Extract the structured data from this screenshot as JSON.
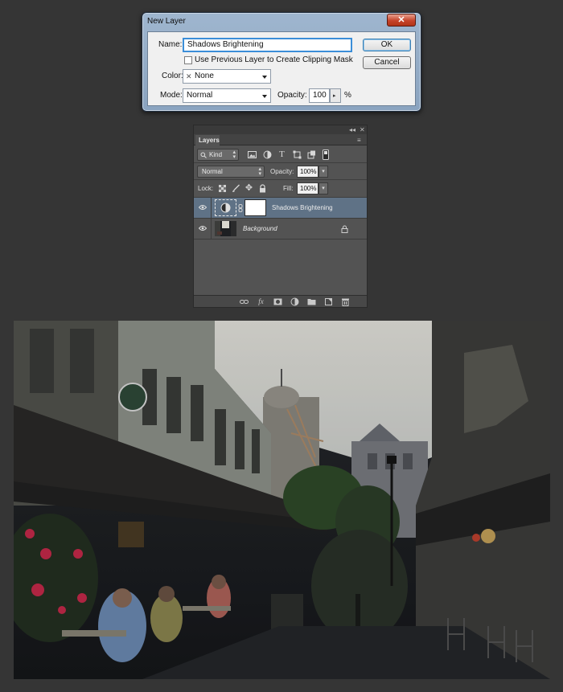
{
  "dialog": {
    "title": "New Layer",
    "close_glyph": "✕",
    "name_label": "Name:",
    "name_value": "Shadows Brightening",
    "clip_checkbox_label": "Use Previous Layer to Create Clipping Mask",
    "clip_checked": false,
    "color_label": "Color:",
    "color_value": "None",
    "color_icon": "x-swatch-icon",
    "mode_label": "Mode:",
    "mode_value": "Normal",
    "opacity_label": "Opacity:",
    "opacity_value": "100",
    "opacity_unit": "%",
    "ok_label": "OK",
    "cancel_label": "Cancel"
  },
  "layers_panel": {
    "tab_label": "Layers",
    "collapse_glyph": "◂◂",
    "close_glyph": "✕",
    "menu_glyph": "≡",
    "filter_value": "Kind",
    "filter_icons": [
      "image-filter-icon",
      "adjustment-filter-icon",
      "type-filter-icon",
      "shape-filter-icon",
      "smart-object-filter-icon",
      "filter-toggle-icon"
    ],
    "blend_mode": "Normal",
    "opacity_label": "Opacity:",
    "opacity_value": "100%",
    "lock_label": "Lock:",
    "lock_icons": [
      "lock-transparent-icon",
      "lock-image-icon",
      "lock-position-icon",
      "lock-all-icon"
    ],
    "fill_label": "Fill:",
    "fill_value": "100%",
    "layers": [
      {
        "name": "Shadows Brightening",
        "selected": true,
        "type": "adjustment",
        "visible": true
      },
      {
        "name": "Background",
        "selected": false,
        "type": "image",
        "visible": true,
        "locked": true
      }
    ],
    "bottom_icons": [
      "link-layers-icon",
      "fx-icon",
      "add-mask-icon",
      "new-adjustment-icon",
      "new-group-icon",
      "new-layer-icon",
      "delete-layer-icon"
    ],
    "fx_glyph": "fx"
  },
  "photo": {
    "description_icon": "street-photo",
    "sky_color": "#e3e2da",
    "shade_color": "#1f2124"
  }
}
